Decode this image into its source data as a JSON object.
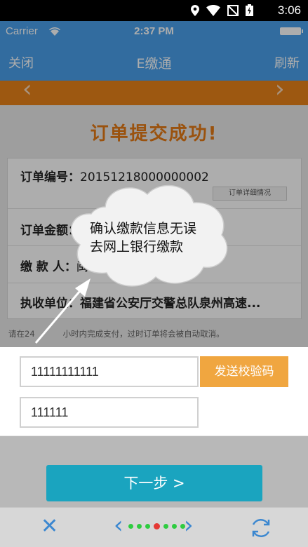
{
  "android_status": {
    "time": "3:06",
    "icons": [
      "location-icon",
      "wifi-icon",
      "no-sim-icon",
      "battery-icon"
    ]
  },
  "ios_status": {
    "carrier": "Carrier",
    "time": "2:37 PM"
  },
  "nav": {
    "close": "关闭",
    "title": "E缴通",
    "refresh": "刷新"
  },
  "success_title": "订单提交成功!",
  "order": {
    "number_label": "订单编号：",
    "number": "20151218000000002",
    "detail_button": "订单详细情况",
    "amount_label": "订单金额：",
    "payer_label": "缴 款 人：",
    "payer_value": "闽",
    "unit_label": "执收单位：",
    "unit_value": "福建省公安厅交警总队泉州高速..."
  },
  "notice_parts": [
    "请在24",
    "小时内完成支付，过时订单将会被自动取消。"
  ],
  "form": {
    "phone_value": "11111111111",
    "send_code": "发送校验码",
    "code_value": "111111",
    "next": "下一步  >"
  },
  "tooltip": {
    "line1": "确认缴款信息无误",
    "line2": "去网上银行缴款"
  },
  "colors": {
    "header": "#4aa0ea",
    "orange": "#e8821a",
    "send_btn": "#f0a640",
    "next_btn": "#1aa4bf",
    "accent_blue": "#3b87d0"
  },
  "pager": {
    "dots": 7,
    "active_index": 3
  }
}
